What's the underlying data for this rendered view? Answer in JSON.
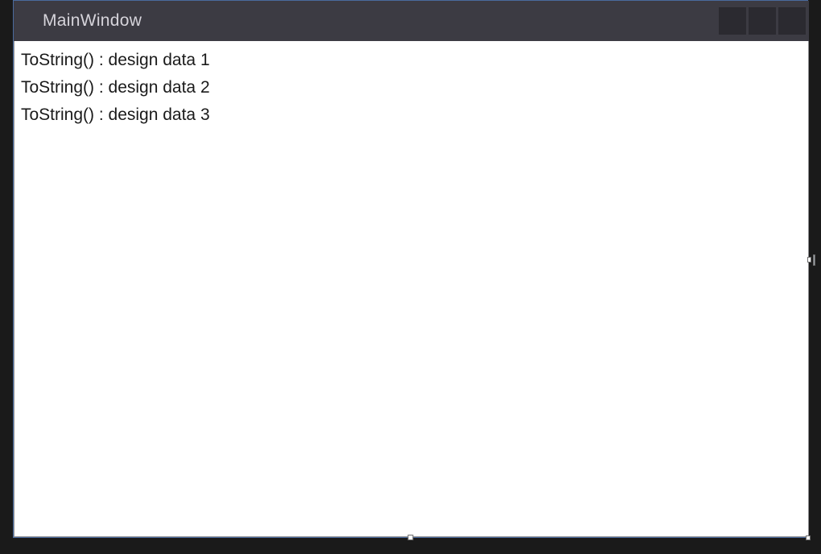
{
  "window": {
    "title": "MainWindow"
  },
  "list": {
    "items": [
      {
        "text": "ToString() : design data 1"
      },
      {
        "text": "ToString() : design data 2"
      },
      {
        "text": "ToString() : design data 3"
      }
    ]
  }
}
